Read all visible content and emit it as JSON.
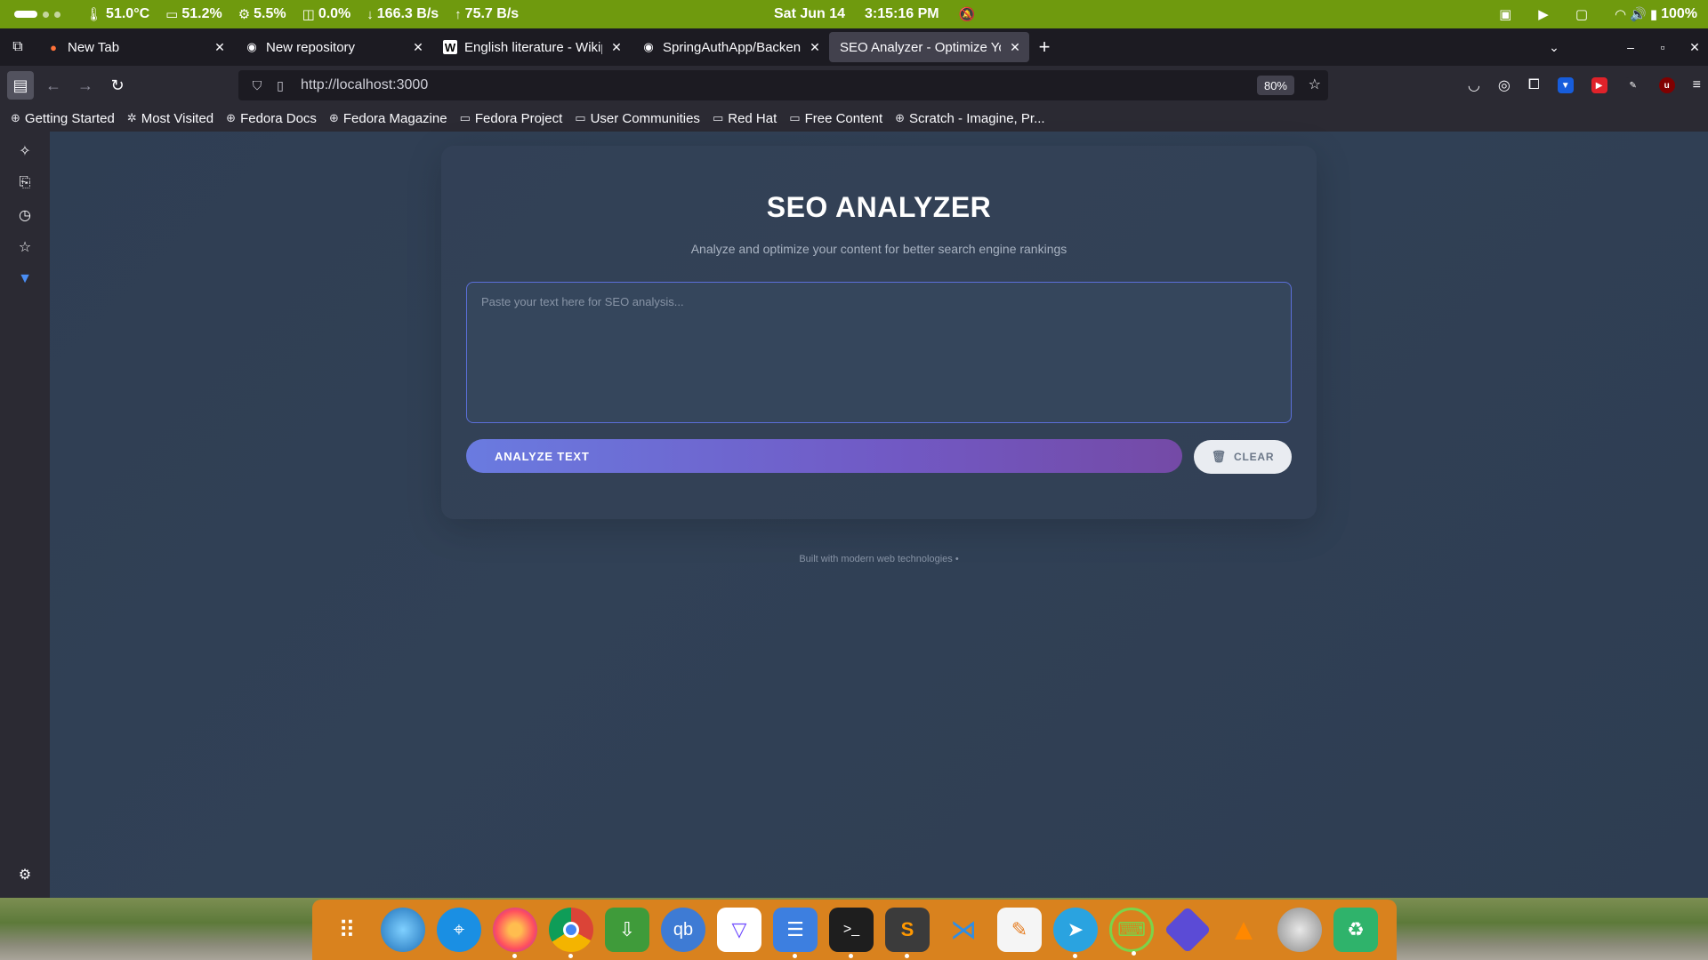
{
  "system_bar": {
    "temp": "51.0°C",
    "memory": "51.2%",
    "cpu": "5.5%",
    "swap": "0.0%",
    "download": "166.3 B/s",
    "upload": "75.7 B/s",
    "date": "Sat Jun 14",
    "time": "3:15:16 PM",
    "battery": "100%"
  },
  "tabs": [
    {
      "title": "New Tab",
      "icon": "firefox-icon",
      "active": false
    },
    {
      "title": "New repository",
      "icon": "github-icon",
      "active": false
    },
    {
      "title": "English literature - Wikip",
      "icon": "wikipedia-icon",
      "active": false
    },
    {
      "title": "SpringAuthApp/Backend",
      "icon": "github-icon",
      "active": false
    },
    {
      "title": "SEO Analyzer - Optimize Yo",
      "icon": "none",
      "active": true
    }
  ],
  "navbar": {
    "url": "http://localhost:3000",
    "zoom": "80%"
  },
  "bookmarks": [
    {
      "label": "Getting Started",
      "icon": "globe-icon"
    },
    {
      "label": "Most Visited",
      "icon": "gear-icon"
    },
    {
      "label": "Fedora Docs",
      "icon": "globe-icon"
    },
    {
      "label": "Fedora Magazine",
      "icon": "globe-icon"
    },
    {
      "label": "Fedora Project",
      "icon": "folder-icon"
    },
    {
      "label": "User Communities",
      "icon": "folder-icon"
    },
    {
      "label": "Red Hat",
      "icon": "folder-icon"
    },
    {
      "label": "Free Content",
      "icon": "folder-icon"
    },
    {
      "label": "Scratch - Imagine, Pr...",
      "icon": "globe-icon"
    }
  ],
  "app": {
    "title": "SEO ANALYZER",
    "subtitle": "Analyze and optimize your content for better search engine rankings",
    "textarea_placeholder": "Paste your text here for SEO analysis...",
    "analyze_label": "ANALYZE TEXT",
    "clear_label": "CLEAR",
    "footer": "Built with modern web technologies •"
  },
  "colors": {
    "system_bar": "#6f9a0e",
    "accent_start": "#6a7be0",
    "accent_end": "#744aa6",
    "dock": "#d9821e"
  },
  "dock_apps": [
    "app-grid-icon",
    "globe-browser-icon",
    "safari-icon",
    "firefox-icon",
    "chrome-icon",
    "download-manager-icon",
    "qbittorrent-icon",
    "proton-vpn-icon",
    "file-manager-icon",
    "terminal-icon",
    "sublime-text-icon",
    "vscode-icon",
    "text-editor-icon",
    "telegram-icon",
    "keyboard-icon",
    "media-player-icon",
    "vlc-icon",
    "disk-icon",
    "recycle-bin-icon"
  ]
}
